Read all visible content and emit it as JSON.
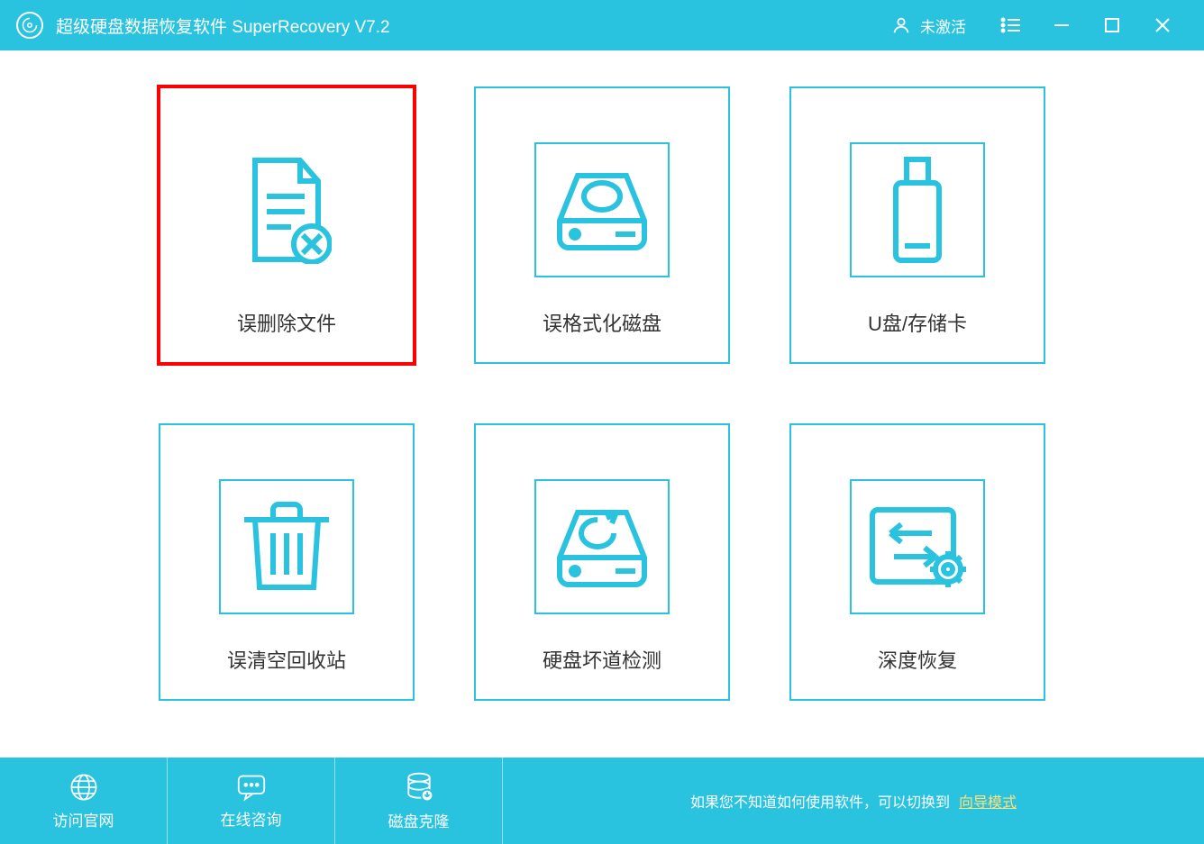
{
  "colors": {
    "accent": "#29c3e0",
    "highlight": "#fe0000",
    "link": "#ffe07a"
  },
  "titlebar": {
    "app_title": "超级硬盘数据恢复软件 SuperRecovery V7.2",
    "activation_label": "未激活"
  },
  "cards": [
    {
      "id": "deleted-files",
      "label": "误删除文件",
      "icon": "file-delete-icon",
      "highlighted": true
    },
    {
      "id": "formatted-disk",
      "label": "误格式化磁盘",
      "icon": "disk-icon"
    },
    {
      "id": "usb-card",
      "label": "U盘/存储卡",
      "icon": "usb-icon"
    },
    {
      "id": "recycle-bin",
      "label": "误清空回收站",
      "icon": "trash-icon"
    },
    {
      "id": "bad-sector",
      "label": "硬盘坏道检测",
      "icon": "hdd-bad-icon"
    },
    {
      "id": "deep-recovery",
      "label": "深度恢复",
      "icon": "swap-gear-icon"
    }
  ],
  "footer": {
    "visit_site": "访问官网",
    "online_chat": "在线咨询",
    "disk_clone": "磁盘克隆",
    "hint_text": "如果您不知道如何使用软件，可以切换到",
    "hint_link": "向导模式"
  }
}
